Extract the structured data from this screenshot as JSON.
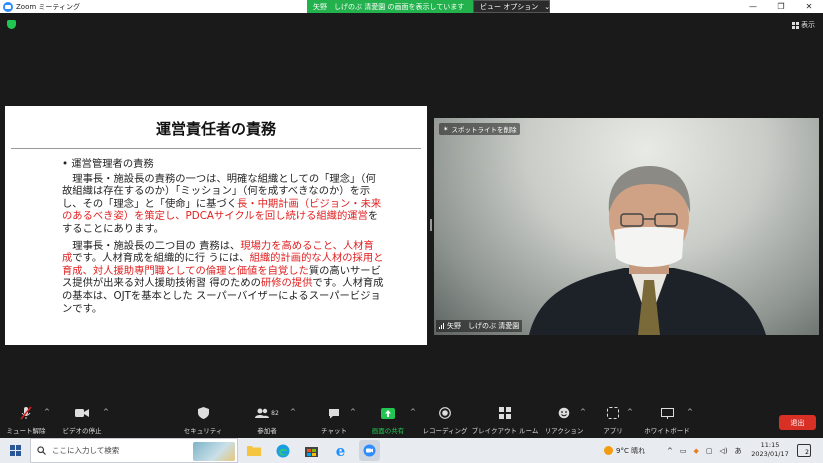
{
  "window": {
    "title": "Zoom ミーティング",
    "controls": [
      "—",
      "❐",
      "✕"
    ]
  },
  "share_banner": {
    "text": "矢野　しげのぶ 清愛園 の画面を表示しています",
    "view_options": "ビュー オプション"
  },
  "view_button": "表示",
  "slide": {
    "title": "運営責任者の責務",
    "bullet": "• 運営管理者の責務",
    "para1_segments": [
      {
        "text": "理事長・施設長の責務の一つは、明確な組織としての「理念」（何 故組織は存在するのか）「ミッション」（何を成すべきなのか）を示 し、その「理念」と「使命」に基づく",
        "red": false
      },
      {
        "text": "長・中期計画（ビジョン・未来 のあるべき姿）を策定し、PDCAサイクルを回し続ける組織的運営",
        "red": true
      },
      {
        "text": "を することにあります。",
        "red": false
      }
    ],
    "para2_segments": [
      {
        "text": "理事長・施設長の二つ目の 責務は、",
        "red": false
      },
      {
        "text": "現場力を高めること、人材育成",
        "red": true
      },
      {
        "text": "です。人材育成を組織的に行 うには、",
        "red": false
      },
      {
        "text": "組織的計画的な人材の採用と育成、対人援助専門職としての倫理と価値を自覚した",
        "red": true
      },
      {
        "text": "質の高いサービス提供が出来る対人援助技術習 得のための",
        "red": false
      },
      {
        "text": "研修の提供",
        "red": true
      },
      {
        "text": "です。人材育成の基本は、OJTを基本とした スーパーバイザーによるスーパービジョンです。",
        "red": false
      }
    ]
  },
  "camera": {
    "spotlight_label": "スポットライトを削除",
    "participant_name": "矢野　しげのぶ 清愛園"
  },
  "toolbar": {
    "mute": "ミュート解除",
    "video": "ビデオの停止",
    "security": "セキュリティ",
    "participants": "参加者",
    "participants_count": "82",
    "chat": "チャット",
    "share": "画面の共有",
    "record": "レコーディング",
    "breakout": "ブレイクアウト ルーム",
    "reactions": "リアクション",
    "apps": "アプリ",
    "whiteboard": "ホワイトボード",
    "leave": "退出"
  },
  "taskbar": {
    "search_placeholder": "ここに入力して検索",
    "weather": "9°C 晴れ",
    "ime": "あ",
    "time": "11:15",
    "date": "2023/01/17",
    "notification_count": "2"
  },
  "colors": {
    "banner_green": "#22b14c",
    "leave_red": "#d93025",
    "slide_red": "#e02020",
    "share_green": "#23c552"
  }
}
